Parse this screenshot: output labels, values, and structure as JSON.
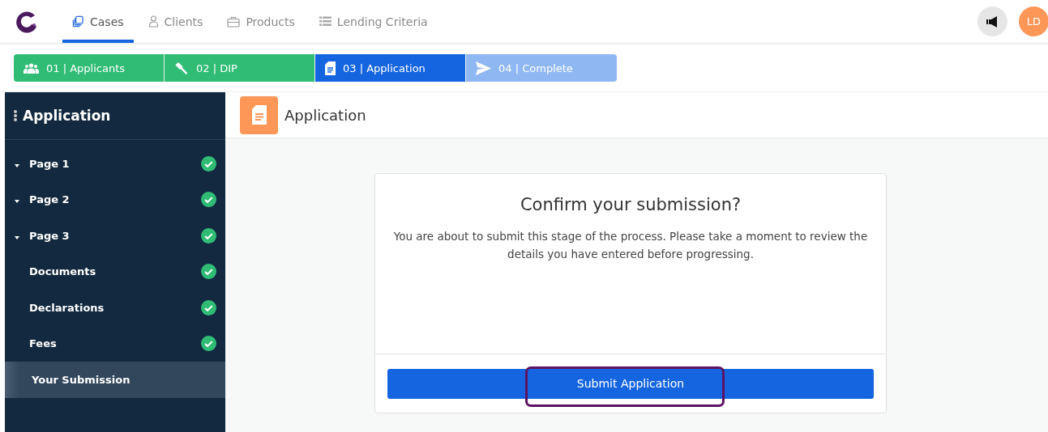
{
  "nav": {
    "avatar": "LD",
    "tabs": [
      {
        "label": "Cases",
        "selected": true
      },
      {
        "label": "Clients",
        "selected": false
      },
      {
        "label": "Products",
        "selected": false
      },
      {
        "label": "Lending Criteria",
        "selected": false
      }
    ]
  },
  "steps": [
    {
      "label": "01 | Applicants",
      "completed": true,
      "selected": false
    },
    {
      "label": "02 | DIP",
      "completed": true,
      "selected": false
    },
    {
      "label": "03 | Application",
      "completed": false,
      "selected": true
    },
    {
      "label": "04 | Complete",
      "completed": false,
      "selected": false
    }
  ],
  "sidebar": {
    "title": "Application",
    "items": [
      {
        "label": "Page 1",
        "kind": "group",
        "done": true,
        "selected": false
      },
      {
        "label": "Page 2",
        "kind": "group",
        "done": true,
        "selected": false
      },
      {
        "label": "Page 3",
        "kind": "group",
        "done": true,
        "selected": false
      },
      {
        "label": "Documents",
        "kind": "page",
        "done": true,
        "selected": false
      },
      {
        "label": "Declarations",
        "kind": "page",
        "done": true,
        "selected": false
      },
      {
        "label": "Fees",
        "kind": "page",
        "done": true,
        "selected": false
      },
      {
        "label": "Your Submission",
        "kind": "page",
        "done": false,
        "selected": true
      }
    ]
  },
  "header": {
    "title": "Application"
  },
  "card": {
    "title": "Confirm your submission?",
    "text": "You are about to submit this stage of the process. Please take a moment to review the details you have entered before progressing.",
    "button": "Submit Application",
    "highlighted": true
  }
}
